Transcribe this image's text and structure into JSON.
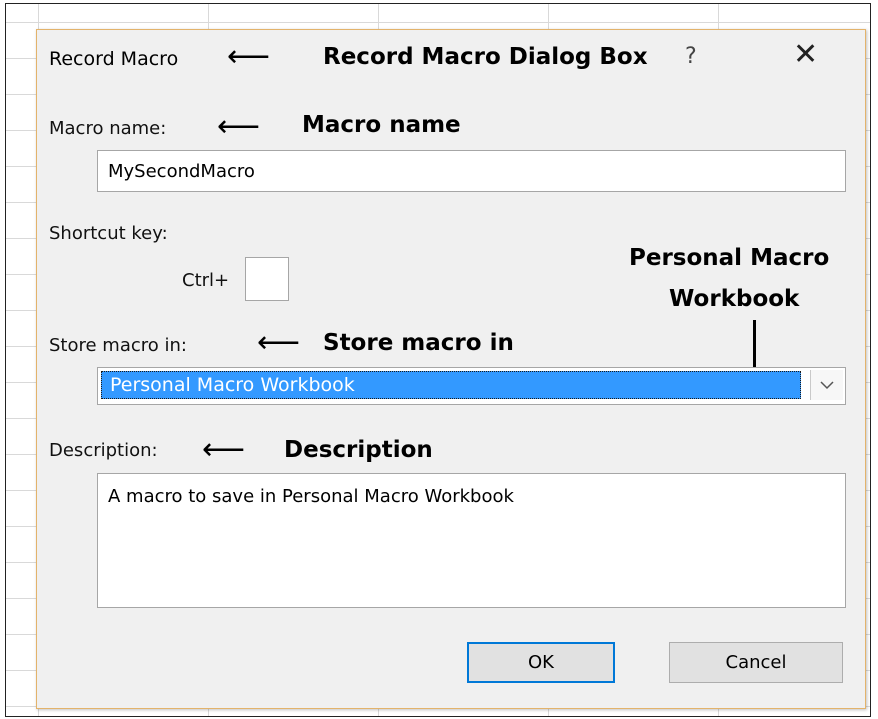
{
  "dialog": {
    "title": "Record Macro",
    "help_label": "?",
    "close_label": "✕",
    "macro_name_label": "Macro name:",
    "macro_name_value": "MySecondMacro",
    "shortcut_key_label": "Shortcut key:",
    "ctrl_label": "Ctrl+",
    "shortcut_key_value": "",
    "store_macro_label": "Store macro in:",
    "store_macro_value": "Personal Macro Workbook",
    "dropdown_icon": "chevron-down-icon",
    "description_label": "Description:",
    "description_value": "A macro to save in Personal Macro Workbook",
    "ok_label": "OK",
    "cancel_label": "Cancel"
  },
  "annotations": {
    "dialog_box": "Record Macro Dialog Box",
    "macro_name": "Macro name",
    "personal_macro_line1": "Personal Macro",
    "personal_macro_line2": "Workbook",
    "store_macro_in": "Store macro in",
    "description": "Description"
  },
  "colors": {
    "selection": "#3399ff",
    "dialog_border": "#e3b36b",
    "default_button_border": "#0078d7"
  }
}
